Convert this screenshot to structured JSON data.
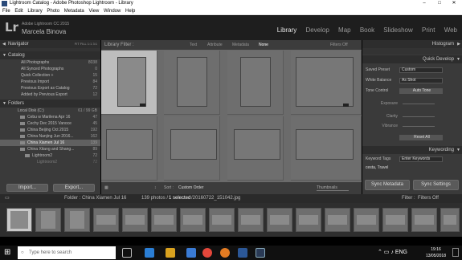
{
  "window": {
    "title": "Lightroom Catalog - Adobe Photoshop Lightroom - Library",
    "controls": [
      "–",
      "□",
      "✕"
    ]
  },
  "menu": [
    "File",
    "Edit",
    "Library",
    "Photo",
    "Metadata",
    "View",
    "Window",
    "Help"
  ],
  "identity": {
    "product": "Adobe Lightroom CC 2015",
    "user": "Marcela Binova",
    "logo": "Lr",
    "modules": [
      "Library",
      "Develop",
      "Map",
      "Book",
      "Slideshow",
      "Print",
      "Web"
    ],
    "active_module": "Library"
  },
  "navigator": {
    "title": "Navigator",
    "zoom": [
      "FIT",
      "FILL",
      "1:1",
      "3:1"
    ]
  },
  "catalog": {
    "title": "Catalog",
    "items": [
      {
        "label": "All Photographs",
        "count": "8038"
      },
      {
        "label": "All Synced Photographs",
        "count": "0"
      },
      {
        "label": "Quick Collection +",
        "count": "15"
      },
      {
        "label": "Previous Import",
        "count": "84"
      },
      {
        "label": "Previous Export as Catalog",
        "count": "72"
      },
      {
        "label": "Added by Previous Export",
        "count": "12"
      }
    ]
  },
  "folders": {
    "title": "Folders",
    "disk": {
      "label": "Local Disk (C:)",
      "count": "61 / 99 GB"
    },
    "items": [
      {
        "label": "Cebu w Marilena Apr 16",
        "count": "47"
      },
      {
        "label": "Cechy Dec 2015 Vanoce",
        "count": "45"
      },
      {
        "label": "China Beijing Oct 2015",
        "count": "192"
      },
      {
        "label": "China Nanjing Jun 2016...",
        "count": "162"
      },
      {
        "label": "China Xiamen Jul 16",
        "count": "139"
      },
      {
        "label": "China Xitang and Shang...",
        "count": "89"
      },
      {
        "label": "Lightroom2",
        "count": "72"
      },
      {
        "label": "Lightroom2",
        "count": "72"
      }
    ]
  },
  "left_buttons": {
    "import": "Import...",
    "export": "Export..."
  },
  "filter": {
    "label": "Library Filter :",
    "tabs": [
      "Text",
      "Attribute",
      "Metadata",
      "None"
    ],
    "active": "None",
    "status": "Filters Off"
  },
  "toolbar": {
    "sort_label": "Sort :",
    "sort_value": "Custom Order",
    "thumbnails": "Thumbnails"
  },
  "histogram": {
    "title": "Histogram"
  },
  "quick_develop": {
    "title": "Quick Develop",
    "saved_preset_label": "Saved Preset",
    "saved_preset_value": "Custom",
    "white_balance_label": "White Balance",
    "white_balance_value": "As Shot",
    "tone_control_label": "Tone Control",
    "auto_tone": "Auto Tone",
    "sliders": [
      "Exposure",
      "Clarity",
      "Vibrance"
    ],
    "reset": "Reset All"
  },
  "keywording": {
    "title": "Keywording",
    "tags_label": "Keyword Tags",
    "tags_value": "Enter Keywords",
    "keywords": "cesta, Travel"
  },
  "right_buttons": {
    "sync_metadata": "Sync Metadata",
    "sync_settings": "Sync Settings"
  },
  "filmstrip": {
    "path": "Folder : China Xiamen Jul 16",
    "count_text": "139 photos /",
    "selected_text": "1 selected",
    "file_text": "/20160722_151042.jpg",
    "filter_label": "Filter :",
    "filter_value": "Filters Off"
  },
  "taskbar": {
    "search_placeholder": "Type here to search",
    "time": "19:16",
    "date": "13/05/2018"
  }
}
